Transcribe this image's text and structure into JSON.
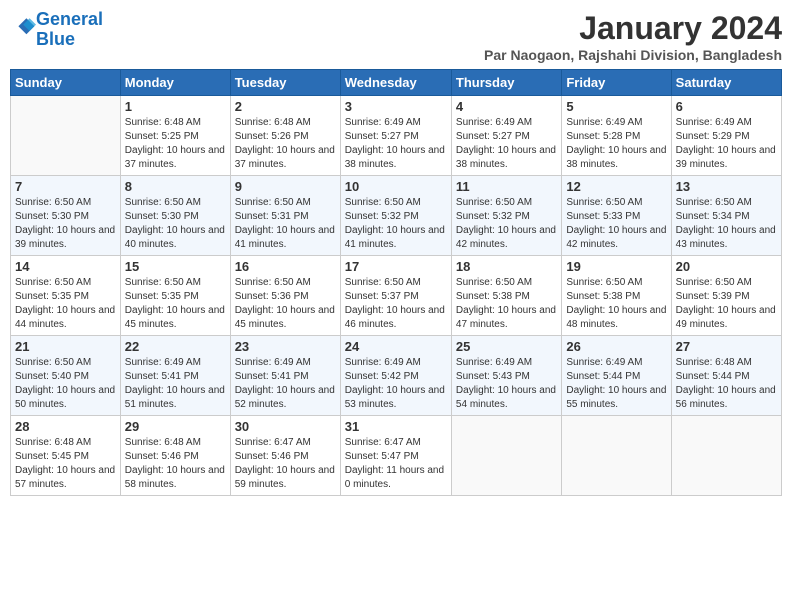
{
  "logo": {
    "line1": "General",
    "line2": "Blue"
  },
  "title": "January 2024",
  "location": "Par Naogaon, Rajshahi Division, Bangladesh",
  "days_of_week": [
    "Sunday",
    "Monday",
    "Tuesday",
    "Wednesday",
    "Thursday",
    "Friday",
    "Saturday"
  ],
  "weeks": [
    [
      {
        "num": "",
        "sunrise": "",
        "sunset": "",
        "daylight": ""
      },
      {
        "num": "1",
        "sunrise": "6:48 AM",
        "sunset": "5:25 PM",
        "daylight": "10 hours and 37 minutes."
      },
      {
        "num": "2",
        "sunrise": "6:48 AM",
        "sunset": "5:26 PM",
        "daylight": "10 hours and 37 minutes."
      },
      {
        "num": "3",
        "sunrise": "6:49 AM",
        "sunset": "5:27 PM",
        "daylight": "10 hours and 38 minutes."
      },
      {
        "num": "4",
        "sunrise": "6:49 AM",
        "sunset": "5:27 PM",
        "daylight": "10 hours and 38 minutes."
      },
      {
        "num": "5",
        "sunrise": "6:49 AM",
        "sunset": "5:28 PM",
        "daylight": "10 hours and 38 minutes."
      },
      {
        "num": "6",
        "sunrise": "6:49 AM",
        "sunset": "5:29 PM",
        "daylight": "10 hours and 39 minutes."
      }
    ],
    [
      {
        "num": "7",
        "sunrise": "6:50 AM",
        "sunset": "5:30 PM",
        "daylight": "10 hours and 39 minutes."
      },
      {
        "num": "8",
        "sunrise": "6:50 AM",
        "sunset": "5:30 PM",
        "daylight": "10 hours and 40 minutes."
      },
      {
        "num": "9",
        "sunrise": "6:50 AM",
        "sunset": "5:31 PM",
        "daylight": "10 hours and 41 minutes."
      },
      {
        "num": "10",
        "sunrise": "6:50 AM",
        "sunset": "5:32 PM",
        "daylight": "10 hours and 41 minutes."
      },
      {
        "num": "11",
        "sunrise": "6:50 AM",
        "sunset": "5:32 PM",
        "daylight": "10 hours and 42 minutes."
      },
      {
        "num": "12",
        "sunrise": "6:50 AM",
        "sunset": "5:33 PM",
        "daylight": "10 hours and 42 minutes."
      },
      {
        "num": "13",
        "sunrise": "6:50 AM",
        "sunset": "5:34 PM",
        "daylight": "10 hours and 43 minutes."
      }
    ],
    [
      {
        "num": "14",
        "sunrise": "6:50 AM",
        "sunset": "5:35 PM",
        "daylight": "10 hours and 44 minutes."
      },
      {
        "num": "15",
        "sunrise": "6:50 AM",
        "sunset": "5:35 PM",
        "daylight": "10 hours and 45 minutes."
      },
      {
        "num": "16",
        "sunrise": "6:50 AM",
        "sunset": "5:36 PM",
        "daylight": "10 hours and 45 minutes."
      },
      {
        "num": "17",
        "sunrise": "6:50 AM",
        "sunset": "5:37 PM",
        "daylight": "10 hours and 46 minutes."
      },
      {
        "num": "18",
        "sunrise": "6:50 AM",
        "sunset": "5:38 PM",
        "daylight": "10 hours and 47 minutes."
      },
      {
        "num": "19",
        "sunrise": "6:50 AM",
        "sunset": "5:38 PM",
        "daylight": "10 hours and 48 minutes."
      },
      {
        "num": "20",
        "sunrise": "6:50 AM",
        "sunset": "5:39 PM",
        "daylight": "10 hours and 49 minutes."
      }
    ],
    [
      {
        "num": "21",
        "sunrise": "6:50 AM",
        "sunset": "5:40 PM",
        "daylight": "10 hours and 50 minutes."
      },
      {
        "num": "22",
        "sunrise": "6:49 AM",
        "sunset": "5:41 PM",
        "daylight": "10 hours and 51 minutes."
      },
      {
        "num": "23",
        "sunrise": "6:49 AM",
        "sunset": "5:41 PM",
        "daylight": "10 hours and 52 minutes."
      },
      {
        "num": "24",
        "sunrise": "6:49 AM",
        "sunset": "5:42 PM",
        "daylight": "10 hours and 53 minutes."
      },
      {
        "num": "25",
        "sunrise": "6:49 AM",
        "sunset": "5:43 PM",
        "daylight": "10 hours and 54 minutes."
      },
      {
        "num": "26",
        "sunrise": "6:49 AM",
        "sunset": "5:44 PM",
        "daylight": "10 hours and 55 minutes."
      },
      {
        "num": "27",
        "sunrise": "6:48 AM",
        "sunset": "5:44 PM",
        "daylight": "10 hours and 56 minutes."
      }
    ],
    [
      {
        "num": "28",
        "sunrise": "6:48 AM",
        "sunset": "5:45 PM",
        "daylight": "10 hours and 57 minutes."
      },
      {
        "num": "29",
        "sunrise": "6:48 AM",
        "sunset": "5:46 PM",
        "daylight": "10 hours and 58 minutes."
      },
      {
        "num": "30",
        "sunrise": "6:47 AM",
        "sunset": "5:46 PM",
        "daylight": "10 hours and 59 minutes."
      },
      {
        "num": "31",
        "sunrise": "6:47 AM",
        "sunset": "5:47 PM",
        "daylight": "11 hours and 0 minutes."
      },
      {
        "num": "",
        "sunrise": "",
        "sunset": "",
        "daylight": ""
      },
      {
        "num": "",
        "sunrise": "",
        "sunset": "",
        "daylight": ""
      },
      {
        "num": "",
        "sunrise": "",
        "sunset": "",
        "daylight": ""
      }
    ]
  ]
}
